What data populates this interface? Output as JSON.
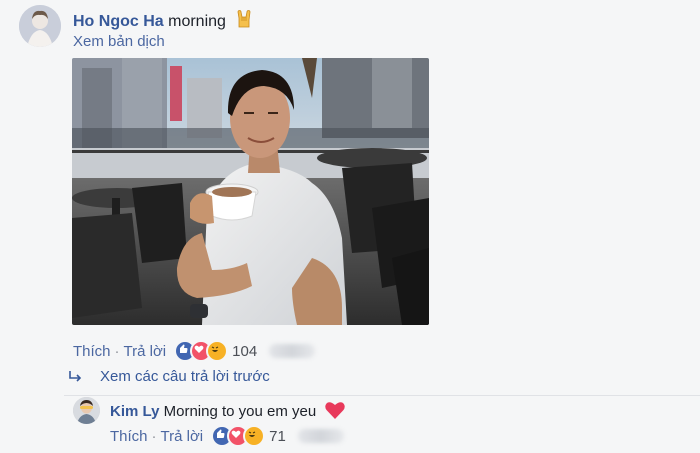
{
  "comment": {
    "author": "Ho Ngoc Ha",
    "text": "morning",
    "translate_label": "Xem bản dịch",
    "actions": {
      "like": "Thích",
      "reply": "Trả lời"
    },
    "reaction_count": "104"
  },
  "replies": {
    "view_previous_label": "Xem các câu trả lời trước",
    "items": [
      {
        "author": "Kim Ly",
        "text": "Morning to you em yeu",
        "actions": {
          "like": "Thích",
          "reply": "Trả lời"
        },
        "reaction_count": "71"
      }
    ]
  },
  "colors": {
    "link": "#365899",
    "like_blue": "#4267b2",
    "love_red": "#f25268",
    "haha_yellow": "#f7b125",
    "heart_red": "#e63946"
  },
  "icons": [
    "rock-hand-emoji",
    "like-reaction-icon",
    "love-reaction-icon",
    "haha-reaction-icon",
    "reply-arrow-icon",
    "heart-emoji"
  ]
}
